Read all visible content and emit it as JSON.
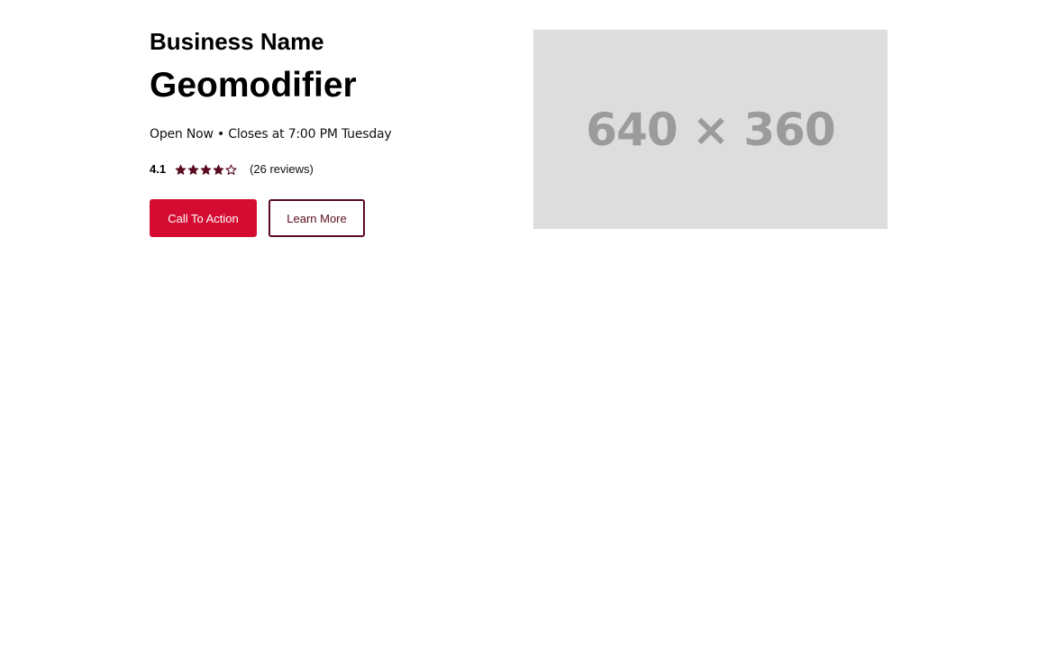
{
  "business": {
    "name": "Business Name",
    "geomodifier": "Geomodifier",
    "hours": "Open Now • Closes at 7:00 PM Tuesday"
  },
  "rating": {
    "value": "4.1",
    "stars_filled": 4,
    "stars_total": 5,
    "reviews": "(26 reviews)"
  },
  "actions": {
    "primary_label": "Call To Action",
    "secondary_label": "Learn More"
  },
  "image": {
    "placeholder": "640 × 360"
  },
  "colors": {
    "primary": "#d50c31",
    "star": "#5a0b1e",
    "placeholder_bg": "#dddddd",
    "placeholder_text": "#9b9b9b"
  }
}
